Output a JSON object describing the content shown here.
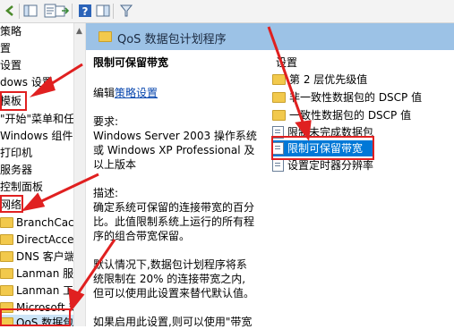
{
  "toolbar": {
    "icons": [
      "back-icon",
      "forward-icon",
      "up-folder-icon",
      "show-hide-tree-icon",
      "export-list-icon",
      "help-icon",
      "properties-icon",
      "filter-icon"
    ]
  },
  "tree": {
    "items": [
      {
        "label": "策略"
      },
      {
        "label": "置"
      },
      {
        "label": "设置"
      },
      {
        "label": "dows 设置"
      },
      {
        "label": "模板"
      },
      {
        "label": "\"开始\"菜单和任务"
      },
      {
        "label": "Windows 组件"
      },
      {
        "label": "打印机"
      },
      {
        "label": "服务器"
      },
      {
        "label": "控制面板"
      },
      {
        "label": "网络"
      },
      {
        "label": "BranchCach"
      },
      {
        "label": "DirectAcces"
      },
      {
        "label": "DNS 客户端"
      },
      {
        "label": "Lanman 服务"
      },
      {
        "label": "Lanman 工作"
      },
      {
        "label": "Microsoft 对"
      },
      {
        "label": "QoS 数据包"
      }
    ]
  },
  "header": {
    "title": "QoS 数据包计划程序"
  },
  "description": {
    "setting_title": "限制可保留带宽",
    "edit_prefix": "编辑",
    "edit_link": "策略设置",
    "requirements_label": "要求:",
    "requirements_lines": [
      "Windows Server 2003 操作系统",
      "或 Windows XP Professional 及",
      "以上版本"
    ],
    "description_label": "描述:",
    "description_lines": [
      "确定系统可保留的连接带宽的百分",
      "比。此值限制系统上运行的所有程",
      "序的组合带宽保留。"
    ],
    "default_lines": [
      "默认情况下,数据包计划程序将系",
      "统限制在 20% 的连接带宽之内,",
      "但可以使用此设置来替代默认值。"
    ],
    "enable_line": "如果启用此设置,则可以使用\"带宽"
  },
  "list": {
    "header": "设置",
    "rows": [
      {
        "label": "第 2 层优先级值",
        "kind": "folder"
      },
      {
        "label": "非一致性数据包的 DSCP 值",
        "kind": "folder"
      },
      {
        "label": "一致性数据包的 DSCP 值",
        "kind": "folder"
      },
      {
        "label": "限制未完成数据包",
        "kind": "policy"
      },
      {
        "label": "限制可保留带宽",
        "kind": "policy",
        "selected": true
      },
      {
        "label": "设置定时器分辨率",
        "kind": "policy"
      }
    ]
  },
  "colors": {
    "accent": "#0078d7",
    "header": "#9cc2e6",
    "annotation": "#e02020"
  }
}
